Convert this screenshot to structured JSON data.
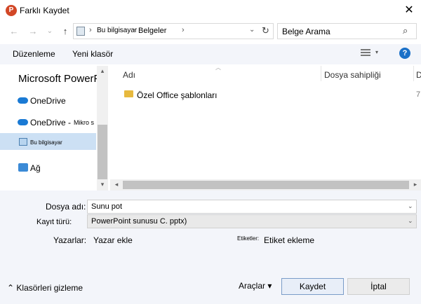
{
  "window": {
    "title": "Farklı Kaydet",
    "app_icon_letter": "P",
    "close_label": "✕"
  },
  "nav": {
    "back": "←",
    "forward": "→",
    "recent": "⌄",
    "up": "↑"
  },
  "address": {
    "crumbs": [
      "Bu bilgisayar",
      "Belgeler"
    ],
    "separator": "›",
    "dropdown": "⌄",
    "refresh": "↻"
  },
  "search": {
    "value": "Belge Arama",
    "icon": "⌕"
  },
  "toolbar": {
    "organize_label": "Düzenleme",
    "new_folder_label": "Yeni klasör",
    "help_label": "?"
  },
  "navpane": {
    "header": "Microsoft PowerPC 'e",
    "items": [
      {
        "label": "OneDrive",
        "sub": ""
      },
      {
        "label": "OneDrive -",
        "sub": "Mikro s"
      },
      {
        "label": "Bu bilgisayar",
        "sub": ""
      },
      {
        "label": "Ağ",
        "sub": ""
      }
    ],
    "selected_index": 2
  },
  "filelist": {
    "columns": [
      "Adı",
      "Dosya sahipliği",
      "D"
    ],
    "rows": [
      {
        "name": "Özel Office şablonları",
        "trailing": "7"
      }
    ]
  },
  "form": {
    "filename_label": "Dosya adı:",
    "filename_value": "Sunu pot",
    "filetype_label": "Kayıt türü:",
    "filetype_value": "PowerPoint sunusu C. pptx)",
    "authors_label": "Yazarlar:",
    "authors_value": "Yazar ekle",
    "tags_label": "Etiketler:",
    "tags_value": "Etiket ekleme"
  },
  "footer": {
    "hide_folders_label": "Klasörleri gizleme",
    "hide_folders_icon": "⌃",
    "tools_label": "Araçlar",
    "tools_caret": "▾",
    "save_label": "Kaydet",
    "cancel_label": "İptal"
  }
}
